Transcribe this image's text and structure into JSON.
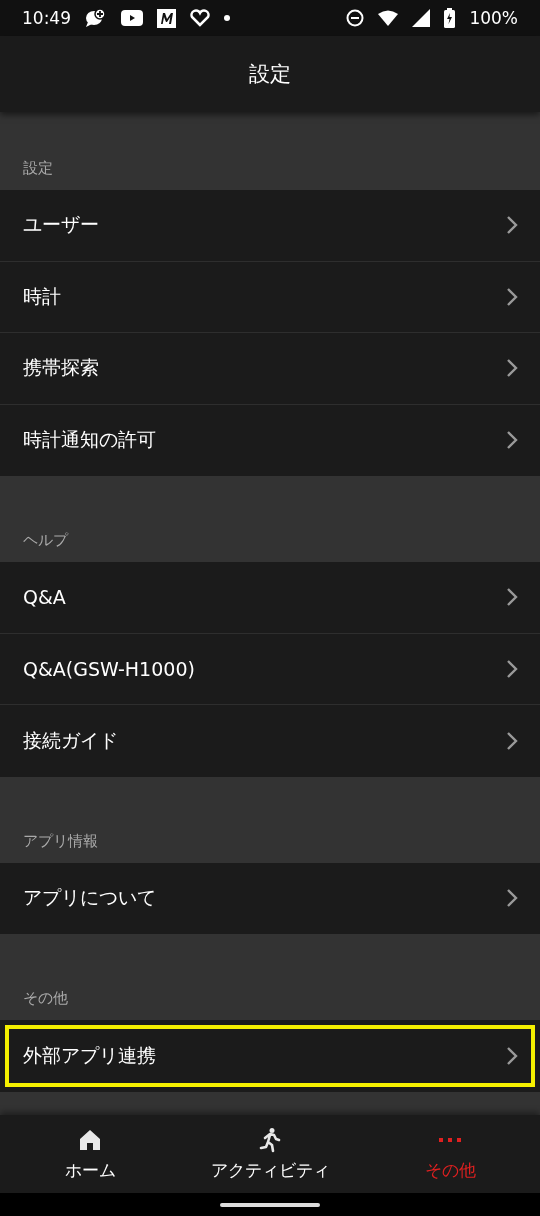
{
  "status_bar": {
    "time": "10:49",
    "battery": "100%"
  },
  "header": {
    "title": "設定"
  },
  "sections": [
    {
      "title": "設定",
      "items": [
        {
          "label": "ユーザー",
          "highlighted": false
        },
        {
          "label": "時計",
          "highlighted": false
        },
        {
          "label": "携帯探索",
          "highlighted": false
        },
        {
          "label": "時計通知の許可",
          "highlighted": false
        }
      ]
    },
    {
      "title": "ヘルプ",
      "items": [
        {
          "label": "Q&A",
          "highlighted": false
        },
        {
          "label": "Q&A(GSW-H1000)",
          "highlighted": false
        },
        {
          "label": "接続ガイド",
          "highlighted": false
        }
      ]
    },
    {
      "title": "アプリ情報",
      "items": [
        {
          "label": "アプリについて",
          "highlighted": false
        }
      ]
    },
    {
      "title": "その他",
      "items": [
        {
          "label": "外部アプリ連携",
          "highlighted": true
        }
      ]
    }
  ],
  "bottom_nav": [
    {
      "kind": "home",
      "label": "ホーム",
      "selected": false
    },
    {
      "kind": "activity",
      "label": "アクティビティ",
      "selected": false
    },
    {
      "kind": "more",
      "label": "その他",
      "selected": true
    }
  ]
}
